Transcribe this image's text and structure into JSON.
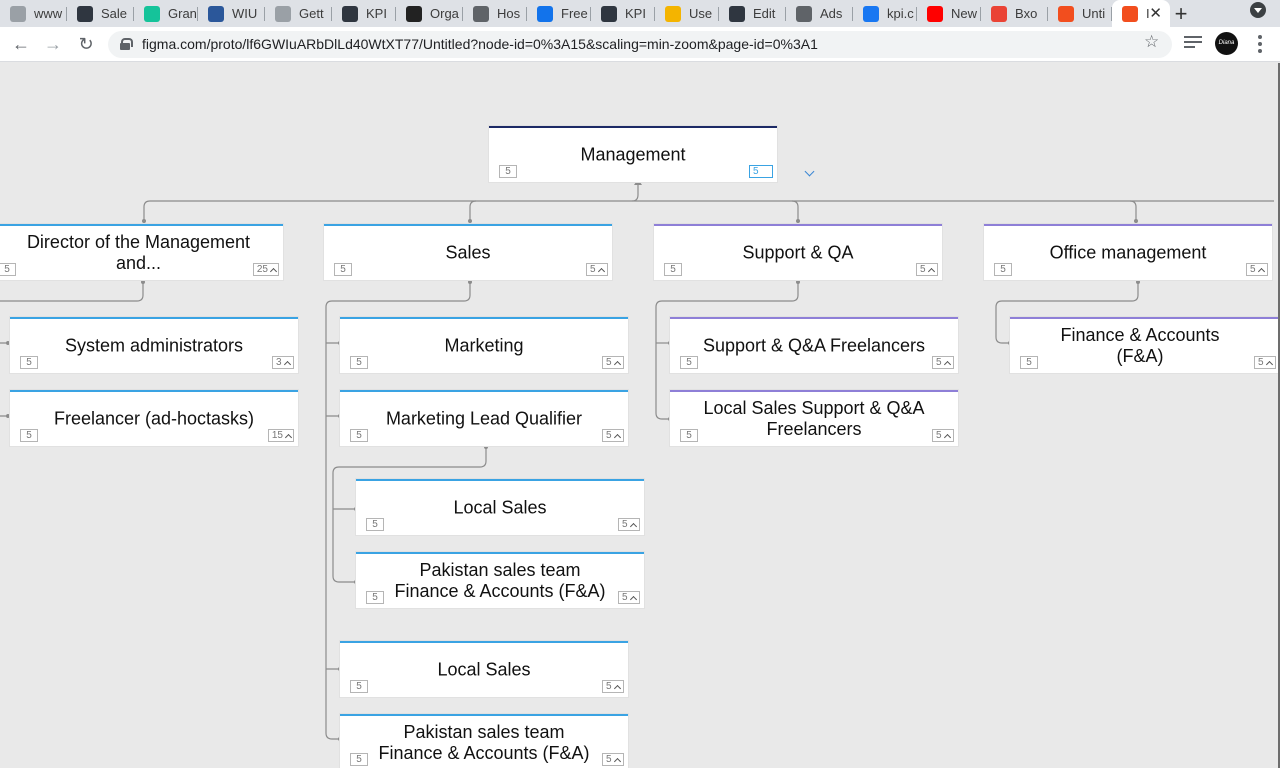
{
  "browser": {
    "tabs": [
      {
        "label": "www",
        "icon": "generic-site-icon",
        "color": "#9aa0a6"
      },
      {
        "label": "Sale",
        "icon": "kpi-icon",
        "color": "#2f3640"
      },
      {
        "label": "Gran",
        "icon": "grammarly-icon",
        "color": "#15c39a"
      },
      {
        "label": "WIU",
        "icon": "word-icon",
        "color": "#2b579a"
      },
      {
        "label": "Gett",
        "icon": "document-icon",
        "color": "#9aa0a6"
      },
      {
        "label": "KPI",
        "icon": "kpi-icon",
        "color": "#2f3640"
      },
      {
        "label": "Orga",
        "icon": "orgchart-icon",
        "color": "#222222"
      },
      {
        "label": "Hos",
        "icon": "chrome-icon",
        "color": "#5f6368"
      },
      {
        "label": "Free",
        "icon": "freepik-icon",
        "color": "#1273eb"
      },
      {
        "label": "KPI",
        "icon": "kpi-icon",
        "color": "#2f3640"
      },
      {
        "label": "Use",
        "icon": "slides-icon",
        "color": "#f4b400"
      },
      {
        "label": "Edit",
        "icon": "kpi-icon",
        "color": "#2f3640"
      },
      {
        "label": "Ads",
        "icon": "ads-icon",
        "color": "#5f6368"
      },
      {
        "label": "kpi.c",
        "icon": "facebook-icon",
        "color": "#1877f2"
      },
      {
        "label": "New",
        "icon": "youtube-icon",
        "color": "#ff0000"
      },
      {
        "label": "Bxo",
        "icon": "gmail-icon",
        "color": "#ea4335"
      },
      {
        "label": "Unti",
        "icon": "figma-icon",
        "color": "#f24e1e"
      },
      {
        "label": "I",
        "icon": "figma-icon",
        "color": "#f24e1e",
        "active": true
      }
    ],
    "new_tab_label": "+",
    "close_tab_label": "✕",
    "url": "figma.com/proto/lf6GWIuARbDlLd40WtXT77/Untitled?node-id=0%3A15&scaling=min-zoom&page-id=0%3A1",
    "profile_label": "Diana"
  },
  "org": {
    "root": {
      "title": "Management",
      "count_left": "5",
      "count_right": "5"
    },
    "departments": [
      {
        "title": "Director of the Management and...",
        "count_left": "5",
        "count_right": "25"
      },
      {
        "title": "Sales",
        "count_left": "5",
        "count_right": "5"
      },
      {
        "title": "Support & QA",
        "count_left": "5",
        "count_right": "5"
      },
      {
        "title": "Office management",
        "count_left": "5",
        "count_right": "5"
      }
    ],
    "director_children": [
      {
        "title": "System administrators",
        "count_left": "5",
        "count_right": "3"
      },
      {
        "title": "Freelancer (ad-hoctasks)",
        "count_left": "5",
        "count_right": "15"
      }
    ],
    "sales_children": [
      {
        "title": "Marketing",
        "count_left": "5",
        "count_right": "5"
      },
      {
        "title": "Marketing Lead Qualifier",
        "count_left": "5",
        "count_right": "5"
      },
      {
        "title": "Local Sales",
        "count_left": "5",
        "count_right": "5"
      },
      {
        "title": "Pakistan sales team Finance & Accounts (F&A)",
        "count_left": "5",
        "count_right": "5"
      }
    ],
    "mlq_children": [
      {
        "title": "Local Sales",
        "count_left": "5",
        "count_right": "5"
      },
      {
        "title": "Pakistan sales team Finance & Accounts (F&A)",
        "count_left": "5",
        "count_right": "5"
      }
    ],
    "support_children": [
      {
        "title": "Support & Q&A Freelancers",
        "count_left": "5",
        "count_right": "5"
      },
      {
        "title": "Local Sales Support & Q&A Freelancers",
        "count_left": "5",
        "count_right": "5"
      }
    ],
    "office_children": [
      {
        "title": "Finance & Accounts (F&A)",
        "count_left": "5",
        "count_right": "5"
      }
    ]
  }
}
